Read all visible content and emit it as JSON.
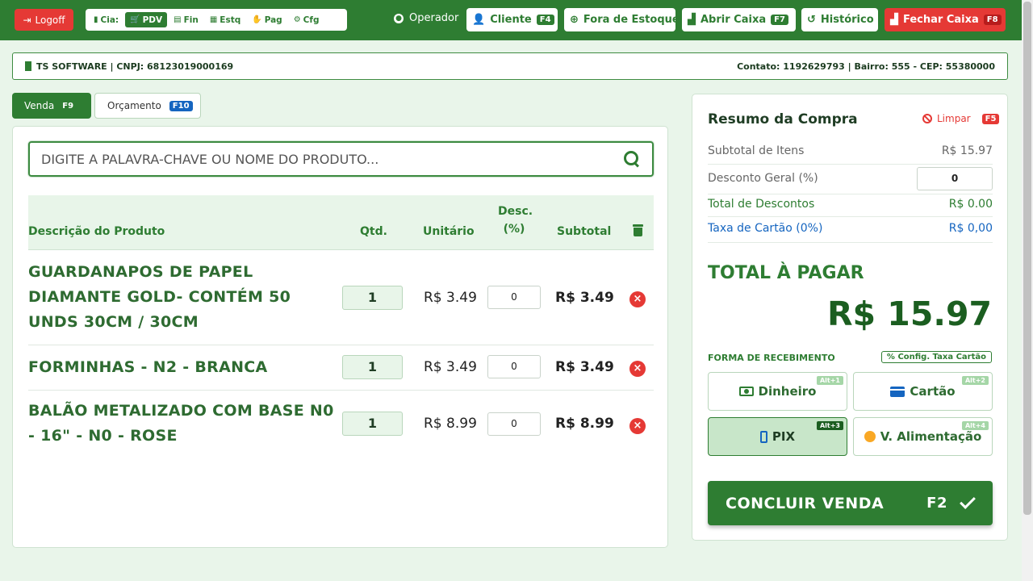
{
  "topbar": {
    "logoff_label": "Logoff",
    "nav": [
      {
        "label": "Cia:",
        "icon": "building-icon"
      },
      {
        "label": "PDV",
        "icon": "cart-icon",
        "active": true
      },
      {
        "label": "Fin",
        "icon": "chart-icon"
      },
      {
        "label": "Estq",
        "icon": "boxes-icon"
      },
      {
        "label": "Pag",
        "icon": "hand-money-icon"
      },
      {
        "label": "Cfg",
        "icon": "gear-icon"
      }
    ],
    "operator_label": "Operador",
    "cliente_label": "Cliente",
    "cliente_key": "F4",
    "fora_estoque_label": "Fora de Estoque",
    "abrir_caixa_label": "Abrir Caixa",
    "abrir_caixa_key": "F7",
    "historico_label": "Histórico",
    "fechar_caixa_label": "Fechar Caixa",
    "fechar_caixa_key": "F8"
  },
  "company": {
    "info": "TS SOFTWARE | CNPJ: 68123019000169",
    "contact": "Contato: 1192629793 | Bairro: 555 - CEP: 55380000"
  },
  "tabs": {
    "venda_label": "Venda",
    "venda_key": "F9",
    "orcamento_label": "Orçamento",
    "orcamento_key": "F10"
  },
  "search": {
    "placeholder": "DIGITE A PALAVRA-CHAVE OU NOME DO PRODUTO..."
  },
  "table": {
    "headers": {
      "description": "Descrição do Produto",
      "qty": "Qtd.",
      "unit": "Unitário",
      "discount_line1": "Desc.",
      "discount_line2": "(%)",
      "subtotal": "Subtotal"
    },
    "rows": [
      {
        "name": "GUARDANAPOS DE PAPEL DIAMANTE GOLD- CONTÉM 50 UNDS 30CM / 30CM",
        "qty": "1",
        "unit": "R$ 3.49",
        "discount": "0",
        "subtotal": "R$ 3.49"
      },
      {
        "name": "FORMINHAS - N2 - BRANCA",
        "qty": "1",
        "unit": "R$ 3.49",
        "discount": "0",
        "subtotal": "R$ 3.49"
      },
      {
        "name": "BALÃO METALIZADO COM BASE N0 - 16\" - N0 - ROSE",
        "qty": "1",
        "unit": "R$ 8.99",
        "discount": "0",
        "subtotal": "R$ 8.99"
      }
    ]
  },
  "summary": {
    "title": "Resumo da Compra",
    "clear_label": "Limpar",
    "clear_key": "F5",
    "subtotal_label": "Subtotal de Itens",
    "subtotal_value": "R$ 15.97",
    "discount_label": "Desconto Geral (%)",
    "discount_value": "0",
    "total_discounts_label": "Total de Descontos",
    "total_discounts_value": "R$ 0.00",
    "card_fee_label": "Taxa de Cartão (0%)",
    "card_fee_value": "R$ 0,00",
    "total_label": "TOTAL À PAGAR",
    "total_value": "R$ 15.97",
    "payment_label": "FORMA DE RECEBIMENTO",
    "config_fee_label": "Config. Taxa Cartão",
    "payments": [
      {
        "label": "Dinheiro",
        "shortcut": "Alt+1"
      },
      {
        "label": "Cartão",
        "shortcut": "Alt+2"
      },
      {
        "label": "PIX",
        "shortcut": "Alt+3",
        "selected": true
      },
      {
        "label": "V. Alimentação",
        "shortcut": "Alt+4"
      }
    ],
    "conclude_label": "CONCLUIR VENDA",
    "conclude_key": "F2"
  },
  "colors": {
    "primary": "#2e7d32",
    "danger": "#e53935",
    "info": "#1565c0",
    "background": "#e9f5ea"
  }
}
